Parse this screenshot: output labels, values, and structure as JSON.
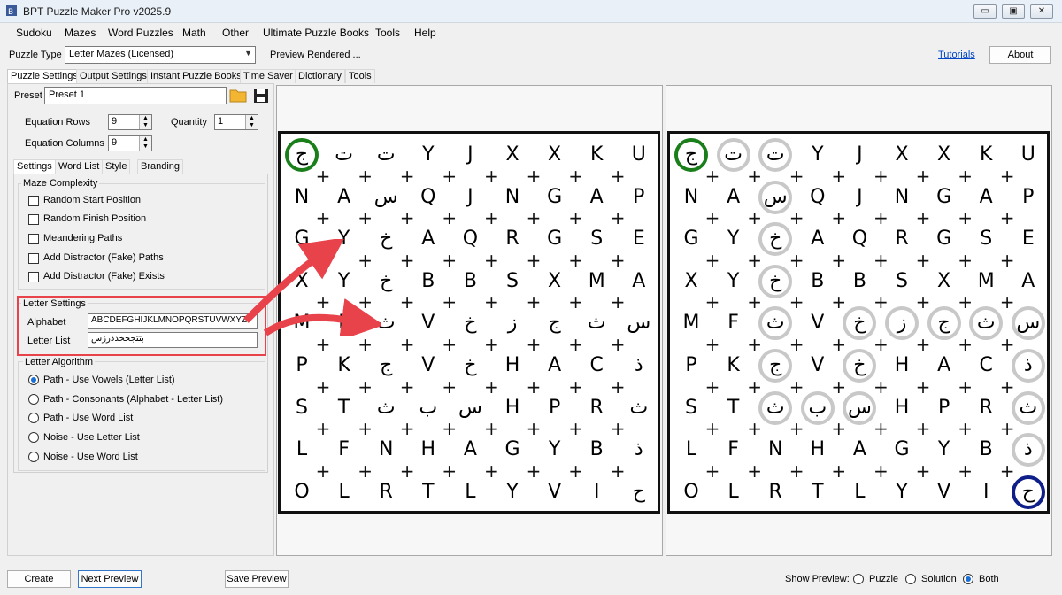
{
  "window": {
    "title": "BPT Puzzle Maker Pro v2025.9",
    "controls": [
      "minimize-icon",
      "maximize-icon",
      "close-icon"
    ]
  },
  "menu": [
    "Sudoku",
    "Mazes",
    "Word Puzzles",
    "Math",
    "Other",
    "Ultimate Puzzle Books",
    "Tools",
    "Help"
  ],
  "puzzle_type": {
    "label": "Puzzle Type",
    "value": "Letter Mazes (Licensed)",
    "status": "Preview Rendered ...",
    "tutorials": "Tutorials",
    "about": "About"
  },
  "tabs": [
    "Puzzle Settings",
    "Output Settings",
    "Instant Puzzle Books",
    "Time Saver",
    "Dictionary",
    "Tools"
  ],
  "preset": {
    "label": "Preset",
    "value": "Preset 1"
  },
  "fields": {
    "rows_label": "Equation Rows",
    "rows_value": "9",
    "quantity_label": "Quantity",
    "quantity_value": "1",
    "cols_label": "Equation Columns",
    "cols_value": "9"
  },
  "subtabs": [
    "Settings",
    "Word List",
    "Style",
    "Branding"
  ],
  "maze_complexity": {
    "title": "Maze Complexity",
    "options": [
      "Random Start Position",
      "Random Finish Position",
      "Meandering Paths",
      "Add Distractor (Fake) Paths",
      "Add Distractor (Fake) Exists"
    ]
  },
  "letter_settings": {
    "title": "Letter Settings",
    "alphabet_label": "Alphabet",
    "alphabet_value": "ABCDEFGHIJKLMNOPQRSTUVWXYZ",
    "letter_list_label": "Letter List",
    "letter_list_value": "بتثجحخدذرزس"
  },
  "letter_algorithm": {
    "title": "Letter Algorithm",
    "options": [
      "Path - Use Vowels (Letter List)",
      "Path - Consonants (Alphabet - Letter List)",
      "Path - Use Word List",
      "Noise - Use Letter List",
      "Noise - Use Word List"
    ],
    "selected": 0
  },
  "maze": {
    "grid": [
      [
        "ج",
        "ت",
        "ت",
        "Y",
        "J",
        "X",
        "X",
        "K",
        "U"
      ],
      [
        "N",
        "A",
        "س",
        "Q",
        "J",
        "N",
        "G",
        "A",
        "P"
      ],
      [
        "G",
        "Y",
        "خ",
        "A",
        "Q",
        "R",
        "G",
        "S",
        "E"
      ],
      [
        "X",
        "Y",
        "خ",
        "B",
        "B",
        "S",
        "X",
        "M",
        "A"
      ],
      [
        "M",
        "F",
        "ث",
        "V",
        "خ",
        "ز",
        "ج",
        "ث",
        "س"
      ],
      [
        "P",
        "K",
        "ج",
        "V",
        "خ",
        "H",
        "A",
        "C",
        "ذ"
      ],
      [
        "S",
        "T",
        "ث",
        "ب",
        "س",
        "H",
        "P",
        "R",
        "ث"
      ],
      [
        "L",
        "F",
        "N",
        "H",
        "A",
        "G",
        "Y",
        "B",
        "ذ"
      ],
      [
        "O",
        "L",
        "R",
        "T",
        "L",
        "Y",
        "V",
        "I",
        "ح"
      ]
    ],
    "path": [
      [
        0,
        0
      ],
      [
        0,
        1
      ],
      [
        0,
        2
      ],
      [
        1,
        2
      ],
      [
        2,
        2
      ],
      [
        3,
        2
      ],
      [
        4,
        2
      ],
      [
        4,
        4
      ],
      [
        4,
        5
      ],
      [
        4,
        6
      ],
      [
        4,
        7
      ],
      [
        4,
        8
      ],
      [
        5,
        8
      ],
      [
        6,
        8
      ],
      [
        7,
        8
      ],
      [
        8,
        8
      ],
      [
        5,
        2
      ],
      [
        6,
        2
      ],
      [
        6,
        3
      ],
      [
        6,
        4
      ],
      [
        5,
        4
      ]
    ],
    "start": [
      0,
      0
    ],
    "finish": [
      8,
      8
    ],
    "colors": {
      "start": "#1a7f1a",
      "finish": "#0f1f8a",
      "path": "#c8c8c8",
      "arrow": "#e8434a"
    }
  },
  "bottom": {
    "create": "Create",
    "next_preview": "Next Preview",
    "save_preview": "Save Preview",
    "show_preview_label": "Show Preview:",
    "options": [
      "Puzzle",
      "Solution",
      "Both"
    ],
    "selected": 2
  }
}
